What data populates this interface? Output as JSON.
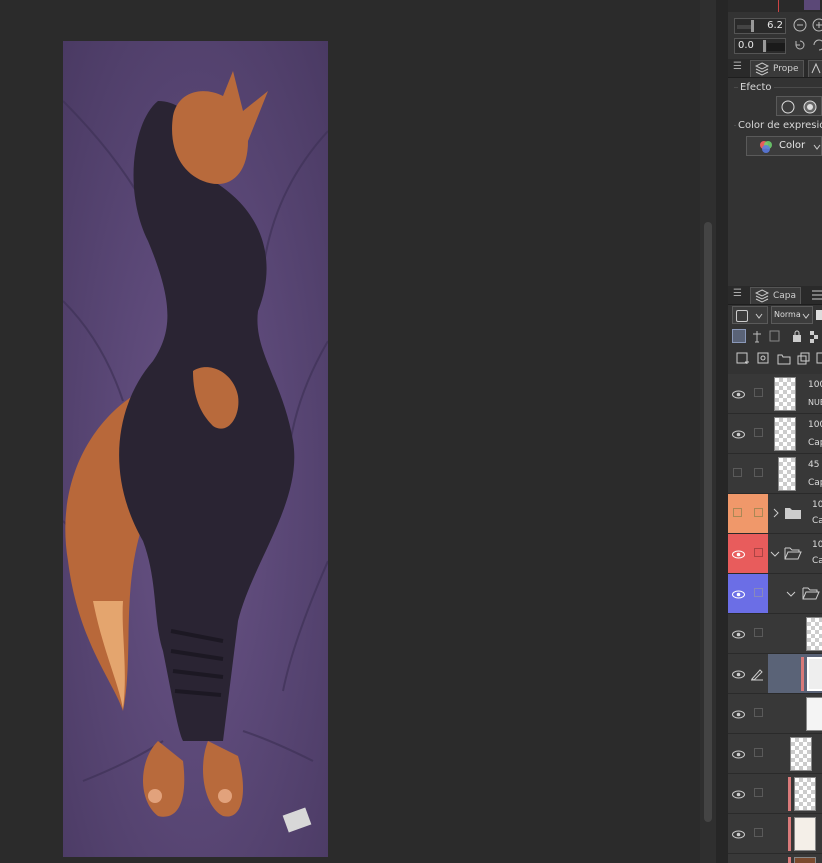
{
  "brush": {
    "size_value": "6.2",
    "opacity_value": "0.0"
  },
  "properties_panel": {
    "tab_label": "Prope",
    "effect_label": "Efecto",
    "expression_color_label": "Color de expresión",
    "expression_color_value": "Color"
  },
  "layers_panel": {
    "tab_label": "Capa",
    "blend_mode": "Norma",
    "layers": [
      {
        "opacity": "100",
        "name": "NUB"
      },
      {
        "opacity": "100",
        "name": "Cap"
      },
      {
        "opacity": "45",
        "name": "Cap"
      },
      {
        "opacity": "10",
        "name": "Ca"
      },
      {
        "opacity": "10",
        "name": "Ca"
      }
    ]
  },
  "colors": {
    "panel_bg": "#333333",
    "canvas_bg": "#2b2b2b",
    "folder_orange": "#f0986a",
    "folder_red": "#e85c5c",
    "folder_blue": "#6b6ee6",
    "selected_row": "#5a6377",
    "artwork_purple": "#5b4877",
    "fox_fur": "#b86a3c",
    "suit_dark": "#2a2433"
  }
}
